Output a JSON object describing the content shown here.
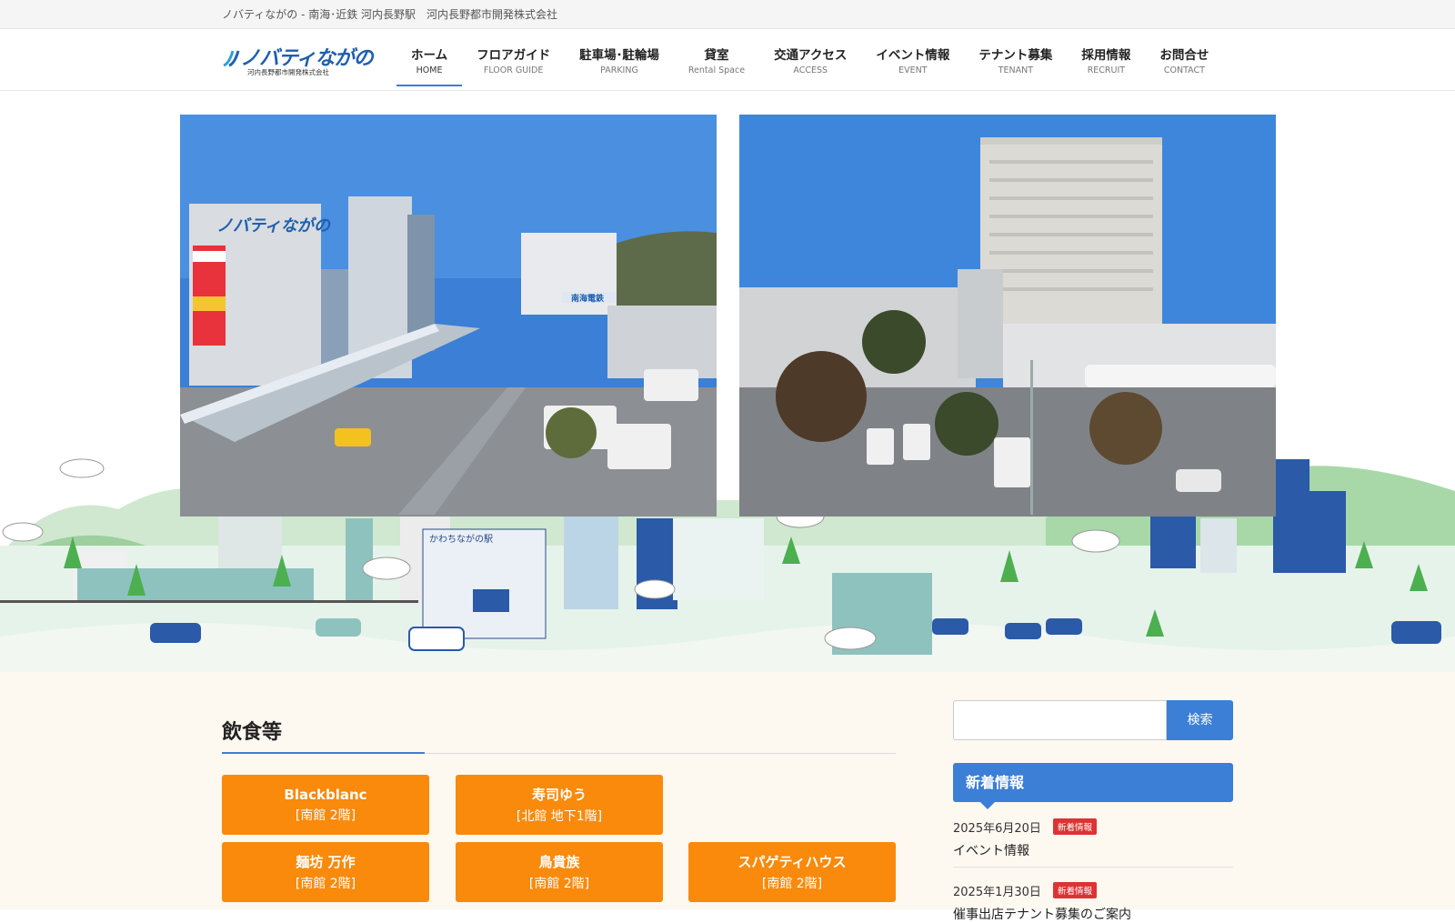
{
  "topbar": {
    "text": "ノバティながの - 南海･近鉄 河内長野駅　河内長野都市開発株式会社"
  },
  "logo": {
    "main": "ノバティながの",
    "sub": "河内長野都市開発株式会社"
  },
  "nav": {
    "items": [
      {
        "ja": "ホーム",
        "en": "HOME"
      },
      {
        "ja": "フロアガイド",
        "en": "FLOOR GUIDE"
      },
      {
        "ja": "駐車場･駐輪場",
        "en": "PARKING"
      },
      {
        "ja": "貸室",
        "en": "Rental Space"
      },
      {
        "ja": "交通アクセス",
        "en": "ACCESS"
      },
      {
        "ja": "イベント情報",
        "en": "EVENT"
      },
      {
        "ja": "テナント募集",
        "en": "TENANT"
      },
      {
        "ja": "採用情報",
        "en": "RECRUIT"
      },
      {
        "ja": "お問合せ",
        "en": "CONTACT"
      }
    ]
  },
  "hero": {
    "station_sign": "かわちながの駅",
    "building_sign": "ノバティながの",
    "railway_sign": "南海電鉄"
  },
  "section": {
    "title": "飲食等",
    "shops": [
      {
        "name": "Blackblanc",
        "floor": "[南館 2階]"
      },
      {
        "name": "寿司ゆう",
        "floor": "[北館 地下1階]"
      },
      {
        "name": "麺坊 万作",
        "floor": "[南館 2階]"
      },
      {
        "name": "鳥貴族",
        "floor": "[南館 2階]"
      },
      {
        "name": "スパゲティハウス",
        "floor": "[南館 2階]"
      }
    ]
  },
  "sidebar": {
    "search_button": "検索",
    "news_heading": "新着情報",
    "news": [
      {
        "date": "2025年6月20日",
        "badge": "新着情報",
        "title": "イベント情報"
      },
      {
        "date": "2025年1月30日",
        "badge": "新着情報",
        "title": "催事出店テナント募集のご案内"
      }
    ]
  },
  "colors": {
    "accent_blue": "#3b7fd6",
    "shop_orange": "#f98a0c",
    "badge_red": "#d33333",
    "main_bg": "#fdf8f0"
  }
}
